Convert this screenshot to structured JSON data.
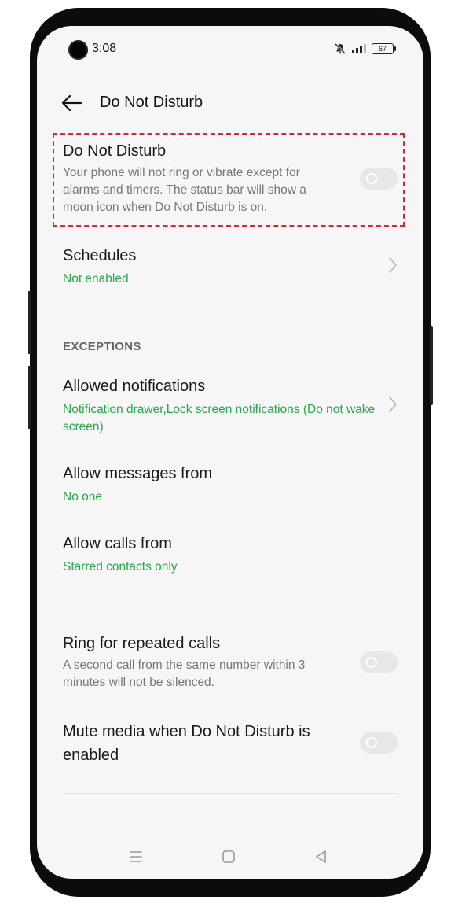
{
  "status_bar": {
    "time": "3:08",
    "battery_level": "67"
  },
  "toolbar": {
    "title": "Do Not Disturb"
  },
  "dnd_toggle": {
    "title": "Do Not Disturb",
    "description": "Your phone will not ring or vibrate except for alarms and timers. The status bar will show a moon icon when Do Not Disturb is on.",
    "enabled": false
  },
  "schedules": {
    "title": "Schedules",
    "status": "Not enabled"
  },
  "exceptions": {
    "header": "EXCEPTIONS",
    "items": [
      {
        "title": "Allowed notifications",
        "value": "Notification drawer,Lock screen notifications (Do not wake screen)"
      },
      {
        "title": "Allow messages from",
        "value": "No one"
      },
      {
        "title": "Allow calls from",
        "value": "Starred contacts only"
      }
    ]
  },
  "repeated_calls": {
    "title": "Ring for repeated calls",
    "description": "A second call from the same number within 3 minutes will not be silenced.",
    "enabled": false
  },
  "mute_media": {
    "title": "Mute media when Do Not Disturb is enabled",
    "enabled": false
  },
  "colors": {
    "accent_green": "#27a84a",
    "highlight_red": "#e2252b",
    "switch_off": "#e7e7e7"
  },
  "nav_bar": {
    "icons": [
      "menu-icon",
      "home-icon",
      "back-triangle-icon"
    ]
  }
}
